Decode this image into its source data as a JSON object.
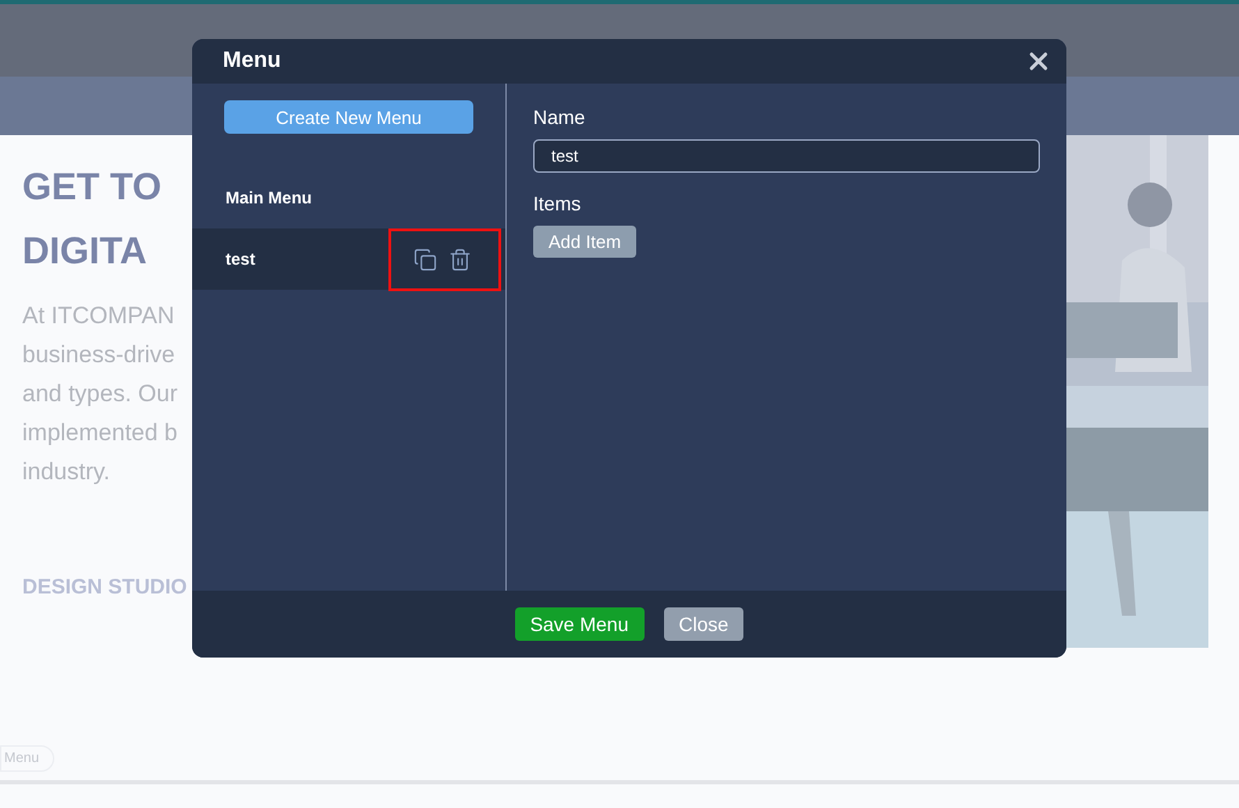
{
  "background": {
    "heading_lines": [
      "GET TO",
      "DIGITA"
    ],
    "paragraph_lines": [
      "At ITCOMPAN",
      "business-drive",
      "and types. Our",
      "implemented b",
      "industry."
    ],
    "logo_text": "DESIGN STUDIO",
    "toolbar_label": "Menu"
  },
  "dialog": {
    "title": "Menu",
    "create_button": "Create New Menu",
    "menus": [
      {
        "name": "Main Menu",
        "selected": false,
        "annotated": false
      },
      {
        "name": "test",
        "selected": true,
        "annotated": true
      }
    ],
    "name_label": "Name",
    "name_value": "test",
    "items_label": "Items",
    "add_item_button": "Add Item",
    "footer_buttons": [
      {
        "label": "Save Menu",
        "kind": "primary"
      },
      {
        "label": "Close",
        "kind": "secondary"
      }
    ]
  }
}
